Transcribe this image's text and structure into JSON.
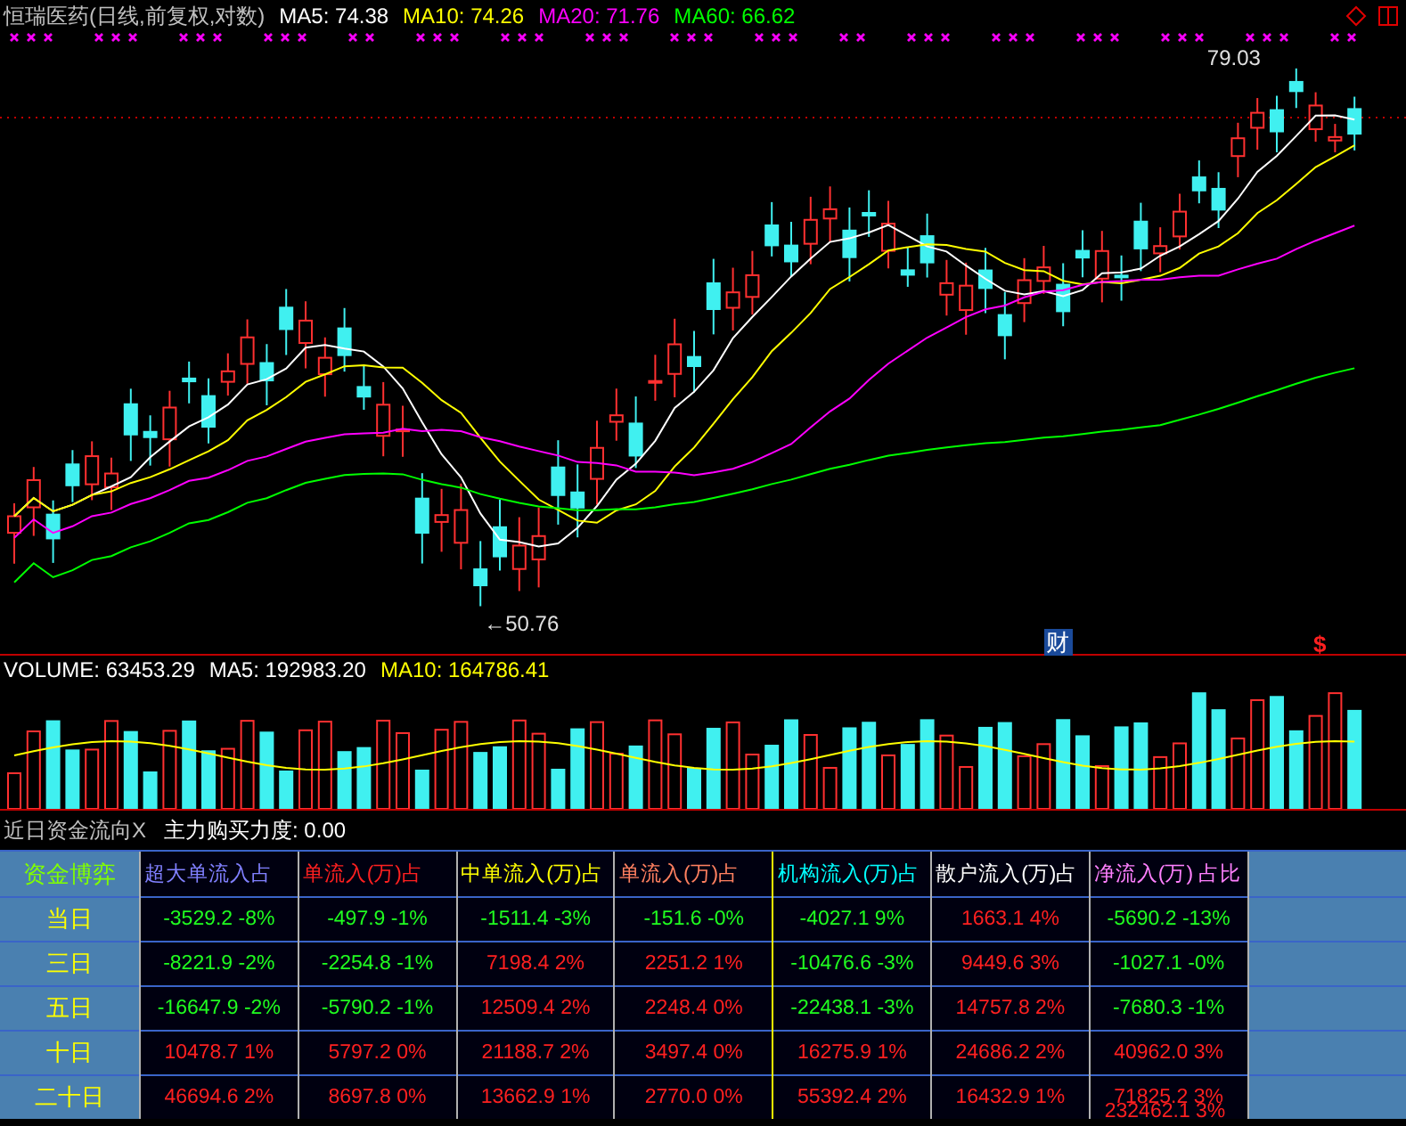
{
  "chart": {
    "title": "恒瑞医药(日线,前复权,对数)",
    "indicators": [
      {
        "label": "MA5: 74.38",
        "color": "#ffffff"
      },
      {
        "label": "MA10: 74.26",
        "color": "#ffff00"
      },
      {
        "label": "MA20: 71.76",
        "color": "#ff00ff"
      },
      {
        "label": "MA60: 66.62",
        "color": "#00ff00"
      }
    ],
    "high_label": "79.03",
    "low_label": "←50.76",
    "event_badge": "财",
    "event_mark": "$"
  },
  "volume": {
    "indicators": [
      {
        "label": "VOLUME: 63453.29",
        "color": "#ffffff"
      },
      {
        "label": "MA5: 192983.20",
        "color": "#ffffff"
      },
      {
        "label": "MA10: 164786.41",
        "color": "#ffff00"
      }
    ]
  },
  "indicator_bar": {
    "name": "近日资金流向X",
    "reading": "主力购买力度: 0.00"
  },
  "table": {
    "corner": "资金博弈",
    "columns": [
      {
        "label": "超大单流入占",
        "color": "#8080ff"
      },
      {
        "label": "单流入(万)占",
        "color": "#ff2020"
      },
      {
        "label": "中单流入(万)占",
        "color": "#ffff00"
      },
      {
        "label": "单流入(万)占",
        "color": "#ff8060"
      },
      {
        "label": "机构流入(万)占",
        "color": "#00ffff"
      },
      {
        "label": "散户流入(万)占",
        "color": "#ffffff"
      },
      {
        "label": "净流入(万) 占比",
        "color": "#ff80ff"
      }
    ],
    "rows": [
      {
        "label": "当日",
        "cells": [
          {
            "text": "-3529.2 -8%",
            "kind": "outflow"
          },
          {
            "text": "-497.9 -1%",
            "kind": "outflow"
          },
          {
            "text": "-1511.4 -3%",
            "kind": "outflow"
          },
          {
            "text": "-151.6 -0%",
            "kind": "outflow"
          },
          {
            "text": "-4027.1 9%",
            "kind": "outflow"
          },
          {
            "text": "1663.1 4%",
            "kind": "inflow"
          },
          {
            "text": "-5690.2 -13%",
            "kind": "outflow"
          }
        ]
      },
      {
        "label": "三日",
        "cells": [
          {
            "text": "-8221.9 -2%",
            "kind": "outflow"
          },
          {
            "text": "-2254.8 -1%",
            "kind": "outflow"
          },
          {
            "text": "7198.4 2%",
            "kind": "inflow"
          },
          {
            "text": "2251.2 1%",
            "kind": "inflow"
          },
          {
            "text": "-10476.6 -3%",
            "kind": "outflow"
          },
          {
            "text": "9449.6 3%",
            "kind": "inflow"
          },
          {
            "text": "-1027.1 -0%",
            "kind": "outflow"
          }
        ]
      },
      {
        "label": "五日",
        "cells": [
          {
            "text": "-16647.9 -2%",
            "kind": "outflow"
          },
          {
            "text": "-5790.2 -1%",
            "kind": "outflow"
          },
          {
            "text": "12509.4 2%",
            "kind": "inflow"
          },
          {
            "text": "2248.4 0%",
            "kind": "inflow"
          },
          {
            "text": "-22438.1 -3%",
            "kind": "outflow"
          },
          {
            "text": "14757.8 2%",
            "kind": "inflow"
          },
          {
            "text": "-7680.3 -1%",
            "kind": "outflow"
          }
        ]
      },
      {
        "label": "十日",
        "cells": [
          {
            "text": "10478.7 1%",
            "kind": "inflow"
          },
          {
            "text": "5797.2 0%",
            "kind": "inflow"
          },
          {
            "text": "21188.7 2%",
            "kind": "inflow"
          },
          {
            "text": "3497.4 0%",
            "kind": "inflow"
          },
          {
            "text": "16275.9 1%",
            "kind": "inflow"
          },
          {
            "text": "24686.2 2%",
            "kind": "inflow"
          },
          {
            "text": "40962.0 3%",
            "kind": "inflow"
          }
        ]
      },
      {
        "label": "二十日",
        "cells": [
          {
            "text": "46694.6 2%",
            "kind": "inflow"
          },
          {
            "text": "8697.8 0%",
            "kind": "inflow"
          },
          {
            "text": "13662.9 1%",
            "kind": "inflow"
          },
          {
            "text": "2770.0 0%",
            "kind": "inflow"
          },
          {
            "text": "55392.4 2%",
            "kind": "inflow"
          },
          {
            "text": "16432.9 1%",
            "kind": "inflow"
          },
          {
            "text": "71825.2 3%",
            "kind": "inflow"
          }
        ]
      }
    ],
    "overflow_text": "232462.1 3%"
  }
}
